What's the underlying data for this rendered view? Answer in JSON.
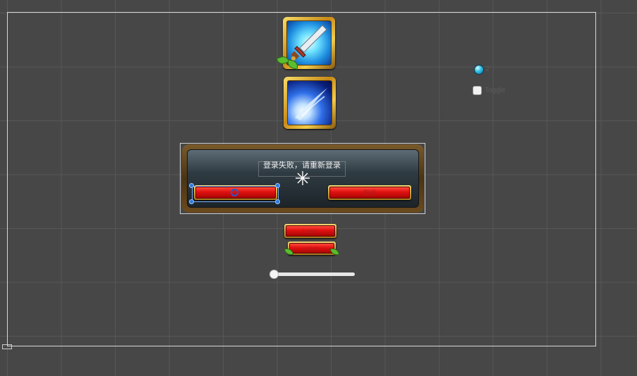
{
  "dialog": {
    "message": "登录失败，请重新登录",
    "ok_button_label": "OK",
    "cancel_button_label": "取消"
  },
  "buttons": {
    "login_label": "Login",
    "start_label": "start"
  },
  "currency": {
    "icon": "gem-icon",
    "count": "2"
  },
  "toggle": {
    "label": "Toggle",
    "checked": false
  },
  "slider": {
    "value": 0
  },
  "icons": {
    "skill_1": "sword-icon",
    "skill_2": "slash-icon"
  },
  "colors": {
    "background": "#474747",
    "grid": "#575757",
    "selection": "#2d7ad9",
    "button_red": "#e01010",
    "gold_frame": "#c98a16"
  }
}
